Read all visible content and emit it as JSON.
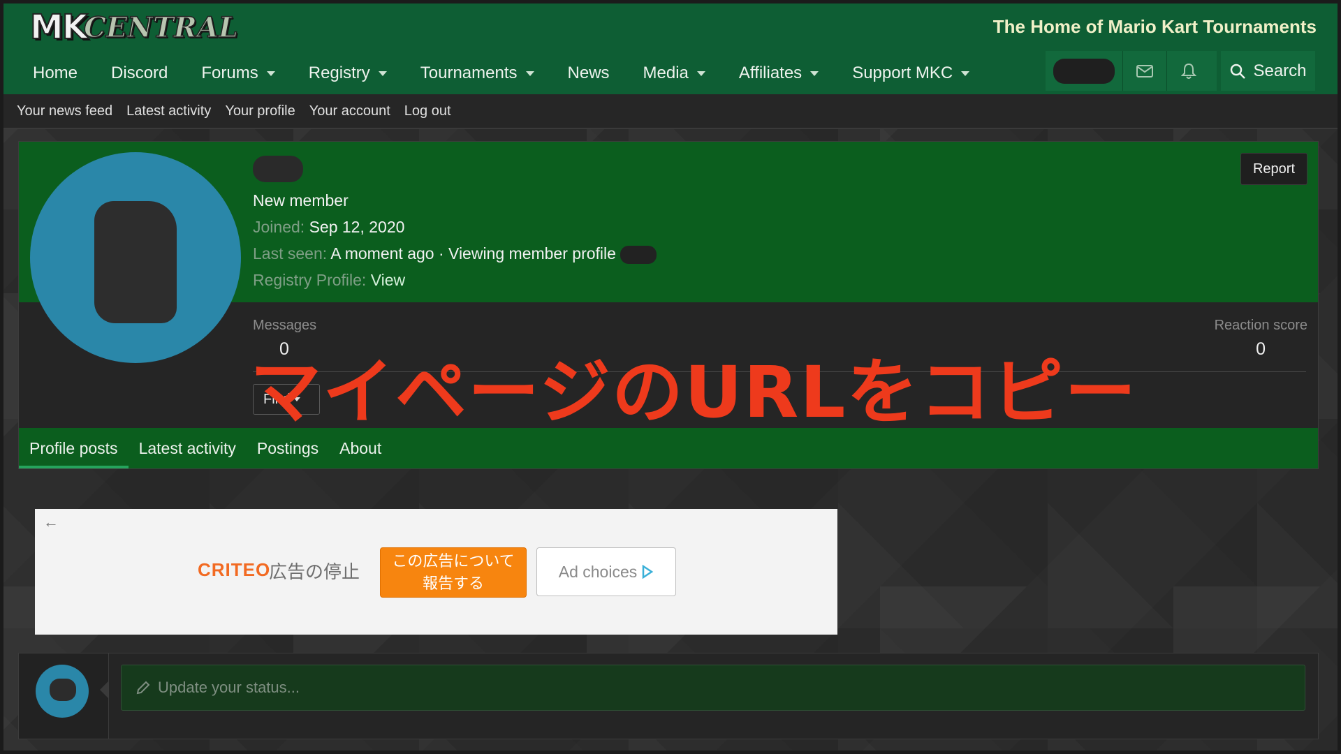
{
  "header": {
    "logo_mk": "MK",
    "logo_central": "CENTRAL",
    "tagline": "The Home of Mario Kart Tournaments"
  },
  "nav": {
    "items": [
      {
        "label": "Home"
      },
      {
        "label": "Discord"
      },
      {
        "label": "Forums"
      },
      {
        "label": "Registry"
      },
      {
        "label": "Tournaments"
      },
      {
        "label": "News"
      },
      {
        "label": "Media"
      },
      {
        "label": "Affiliates"
      },
      {
        "label": "Support MKC"
      }
    ],
    "search_label": "Search"
  },
  "subnav": {
    "items": [
      "Your news feed",
      "Latest activity",
      "Your profile",
      "Your account",
      "Log out"
    ]
  },
  "profile": {
    "title": "New member",
    "joined_label": "Joined:",
    "joined_value": "Sep 12, 2020",
    "last_seen_label": "Last seen:",
    "last_seen_value": "A moment ago · Viewing member profile",
    "registry_label": "Registry Profile:",
    "registry_value": "View",
    "report_label": "Report",
    "messages_label": "Messages",
    "messages_value": "0",
    "reaction_label": "Reaction score",
    "reaction_value": "0",
    "find_label": "Find",
    "tabs": [
      "Profile posts",
      "Latest activity",
      "Postings",
      "About"
    ]
  },
  "overlay": {
    "text": "マイページのURLをコピー"
  },
  "ad": {
    "back": "←",
    "brand": "CRITEO",
    "stop": "広告の停止",
    "report_line1": "この広告について",
    "report_line2": "報告する",
    "choices": "Ad choices"
  },
  "status": {
    "placeholder": "Update your status..."
  }
}
